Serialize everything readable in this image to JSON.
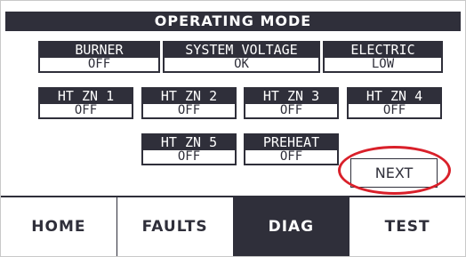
{
  "header": {
    "title": "OPERATING MODE"
  },
  "status": {
    "burner": {
      "label": "BURNER",
      "value": "OFF"
    },
    "system_voltage": {
      "label": "SYSTEM VOLTAGE",
      "value": "OK"
    },
    "electric": {
      "label": "ELECTRIC",
      "value": "LOW"
    },
    "ht_zn_1": {
      "label": "HT ZN 1",
      "value": "OFF"
    },
    "ht_zn_2": {
      "label": "HT ZN 2",
      "value": "OFF"
    },
    "ht_zn_3": {
      "label": "HT ZN 3",
      "value": "OFF"
    },
    "ht_zn_4": {
      "label": "HT ZN 4",
      "value": "OFF"
    },
    "ht_zn_5": {
      "label": "HT ZN 5",
      "value": "OFF"
    },
    "preheat": {
      "label": "PREHEAT",
      "value": "OFF"
    }
  },
  "next_button": {
    "label": "NEXT"
  },
  "nav": {
    "items": [
      {
        "label": "HOME",
        "active": false
      },
      {
        "label": "FAULTS",
        "active": false
      },
      {
        "label": "DIAG",
        "active": true
      },
      {
        "label": "TEST",
        "active": false
      }
    ]
  },
  "colors": {
    "panel": "#2f2f3a",
    "background": "#ffffff",
    "highlight": "#d9202a"
  }
}
